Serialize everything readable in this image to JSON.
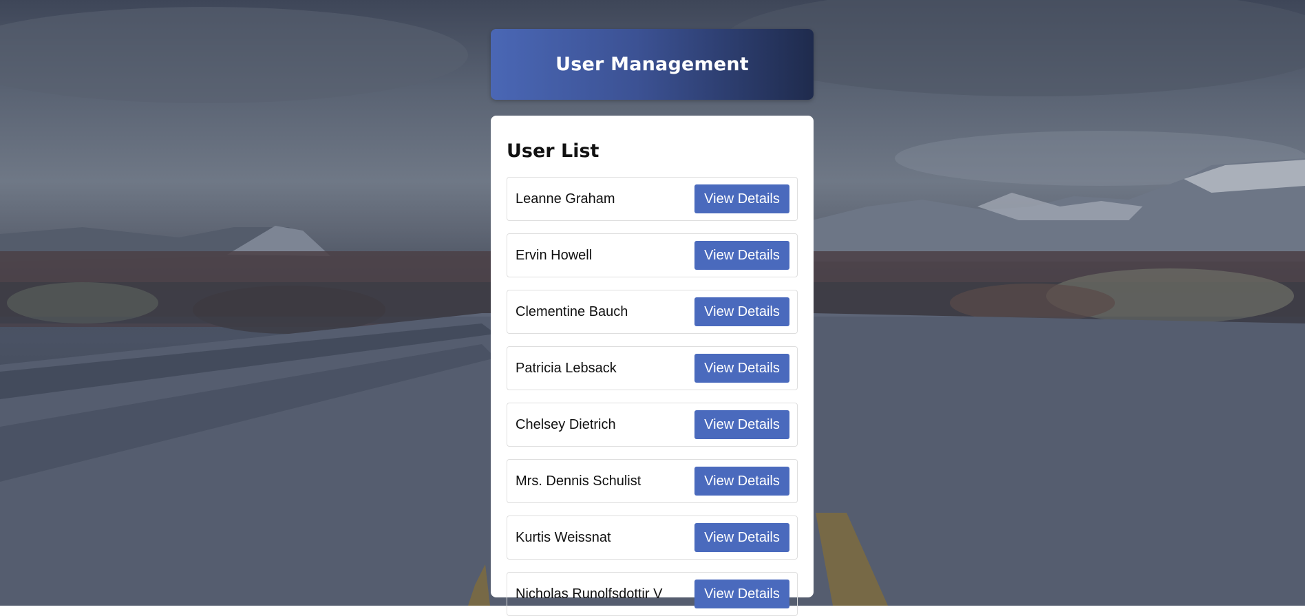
{
  "header": {
    "title": "User Management"
  },
  "user_list": {
    "heading": "User List",
    "action_label": "View Details",
    "users": [
      {
        "name": "Leanne Graham"
      },
      {
        "name": "Ervin Howell"
      },
      {
        "name": "Clementine Bauch"
      },
      {
        "name": "Patricia Lebsack"
      },
      {
        "name": "Chelsey Dietrich"
      },
      {
        "name": "Mrs. Dennis Schulist"
      },
      {
        "name": "Kurtis Weissnat"
      },
      {
        "name": "Nicholas Runolfsdottir V"
      }
    ]
  },
  "colors": {
    "header_gradient_start": "#4a67b5",
    "header_gradient_end": "#1f2b4d",
    "button": "#4a6abd"
  }
}
